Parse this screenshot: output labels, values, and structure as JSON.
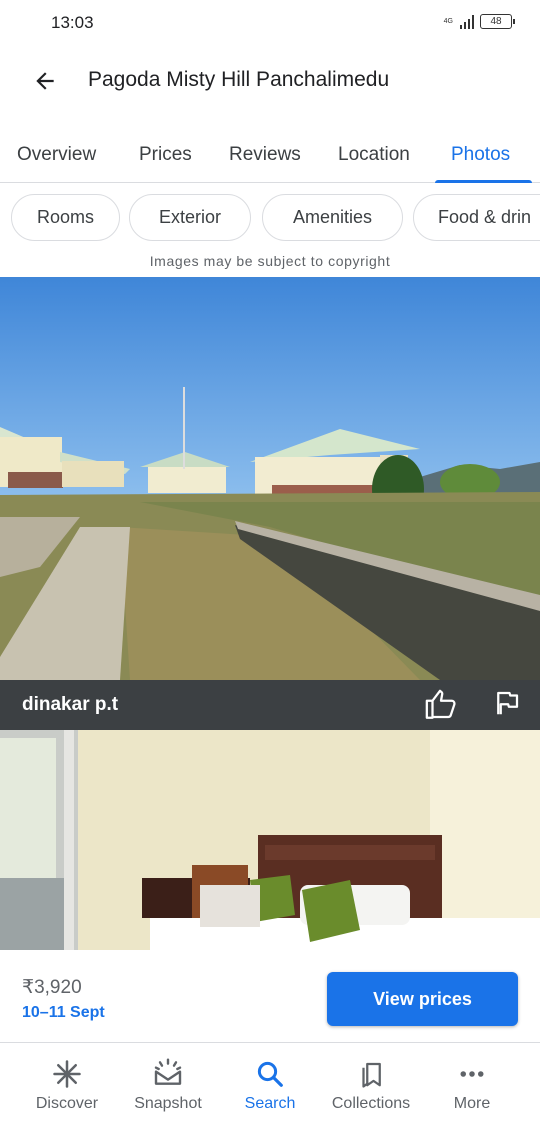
{
  "status_bar": {
    "time": "13:03",
    "network": "4G",
    "battery": "48"
  },
  "header": {
    "title": "Pagoda Misty Hill Panchalimedu"
  },
  "tabs": [
    {
      "label": "Overview"
    },
    {
      "label": "Prices"
    },
    {
      "label": "Reviews"
    },
    {
      "label": "Location"
    },
    {
      "label": "Photos",
      "active": true
    }
  ],
  "chips": [
    {
      "label": "Rooms"
    },
    {
      "label": "Exterior"
    },
    {
      "label": "Amenities"
    },
    {
      "label": "Food & drin"
    }
  ],
  "copyright_notice": "Images may be subject to copyright",
  "photo": {
    "author": "dinakar p.t"
  },
  "price_bar": {
    "price": "₹3,920",
    "dates": "10–11 Sept",
    "button_label": "View prices"
  },
  "bottom_nav": [
    {
      "label": "Discover",
      "icon": "asterisk-icon"
    },
    {
      "label": "Snapshot",
      "icon": "snapshot-icon"
    },
    {
      "label": "Search",
      "icon": "search-icon",
      "active": true
    },
    {
      "label": "Collections",
      "icon": "bookmarks-icon"
    },
    {
      "label": "More",
      "icon": "more-dots-icon"
    }
  ],
  "colors": {
    "accent": "#1a73e8",
    "photo_bar": "#3c4043",
    "text_secondary": "#5f6368"
  }
}
